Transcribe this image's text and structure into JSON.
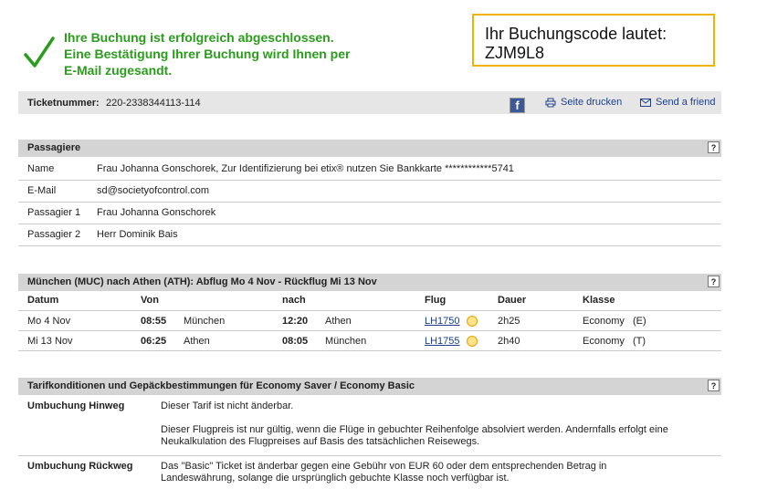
{
  "confirmation": {
    "line1": "Ihre Buchung ist erfolgreich abgeschlossen.",
    "line2": "Eine Bestätigung Ihrer Buchung wird Ihnen per",
    "line3": "E-Mail zugesandt."
  },
  "booking_code": {
    "label": "Ihr Buchungscode lautet:",
    "code": "ZJM9L8"
  },
  "ticket": {
    "label": "Ticketnummer:",
    "value": "220-2338344113-114",
    "print_label": "Seite drucken",
    "send_label": "Send a friend"
  },
  "passengers": {
    "title": "Passagiere",
    "help": "?",
    "rows": [
      {
        "key": "Name",
        "value": "Frau  Johanna Gonschorek, Zur Identifizierung bei etix® nutzen Sie Bankkarte ************5741"
      },
      {
        "key": "E-Mail",
        "value": "sd@societyofcontrol.com"
      },
      {
        "key": "Passagier 1",
        "value": "Frau Johanna Gonschorek"
      },
      {
        "key": "Passagier 2",
        "value": "Herr Dominik Bais"
      }
    ]
  },
  "flights": {
    "title": "München (MUC)  nach  Athen (ATH):  Abflug  Mo 4 Nov -  Rückflug  Mi 13 Nov",
    "help": "?",
    "headers": {
      "datum": "Datum",
      "von": "Von",
      "nach": "nach",
      "flug": "Flug",
      "dauer": "Dauer",
      "klasse": "Klasse"
    },
    "rows": [
      {
        "datum": "Mo 4 Nov",
        "dep_time": "08:55",
        "dep_city": "München",
        "arr_time": "12:20",
        "arr_city": "Athen",
        "flug": "LH1750",
        "dauer": "2h25",
        "klasse": "Economy",
        "code": "(E)"
      },
      {
        "datum": "Mi 13 Nov",
        "dep_time": "06:25",
        "dep_city": "Athen",
        "arr_time": "08:05",
        "arr_city": "München",
        "flug": "LH1755",
        "dauer": "2h40",
        "klasse": "Economy",
        "code": "(T)"
      }
    ]
  },
  "tariff": {
    "title": "Tarifkonditionen und Gepäckbestimmungen für  Economy Saver / Economy Basic",
    "help": "?",
    "hin_label": "Umbuchung Hinweg",
    "hin_text1": "Dieser Tarif ist nicht änderbar.",
    "hin_text2": "Dieser Flugpreis ist nur gültig, wenn die Flüge in gebuchter Reihenfolge absolviert werden. Andernfalls erfolgt eine Neukalkulation des Flugpreises auf Basis des tatsächlichen Reisewegs.",
    "rueck_label": "Umbuchung Rückweg",
    "rueck_text": "Das \"Basic\" Ticket ist änderbar gegen eine Gebühr von EUR 60 oder dem entsprechenden Betrag in Landeswährung, solange die ursprünglich gebuchte Klasse noch verfügbar ist."
  },
  "colors": {
    "success": "#2a9d1c",
    "code_border": "#f0b400",
    "link": "#1f3f8a"
  }
}
